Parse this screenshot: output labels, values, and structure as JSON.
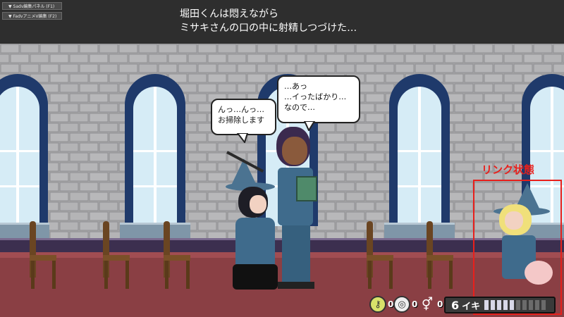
{
  "debug_panels": [
    {
      "label": "▼ Sadv編集パネル (F1)"
    },
    {
      "label": "▼ FadvアニメV編集 (F2)"
    }
  ],
  "narration": {
    "line1": "堀田くんは悶えながら",
    "line2": "ミサキさんの口の中に射精しつづけた…"
  },
  "bubbles": {
    "girl": {
      "line1": "んっ…んっ…",
      "line2": "お掃除します"
    },
    "boy": {
      "line1": "…あっ",
      "line2": "…イったばかり…",
      "line3": "なので…"
    }
  },
  "link_state": {
    "label": "リンク状態",
    "color": "#e8201c"
  },
  "hud": {
    "items": [
      {
        "icon": "key-icon",
        "count": "0"
      },
      {
        "icon": "coin-icon",
        "count": "0"
      },
      {
        "icon": "male-female-icon",
        "count": "0"
      }
    ],
    "iki": {
      "value": "6",
      "label": "イキ",
      "segments_total": 10,
      "segments_filled": 5
    }
  },
  "colors": {
    "wall": "#a9a9ab",
    "window_frame": "#1f3a6b",
    "window_glass": "#d6ecf6",
    "floor": "#8a3f44",
    "uniform": "#3f6b8c",
    "accent_red": "#e8201c"
  }
}
